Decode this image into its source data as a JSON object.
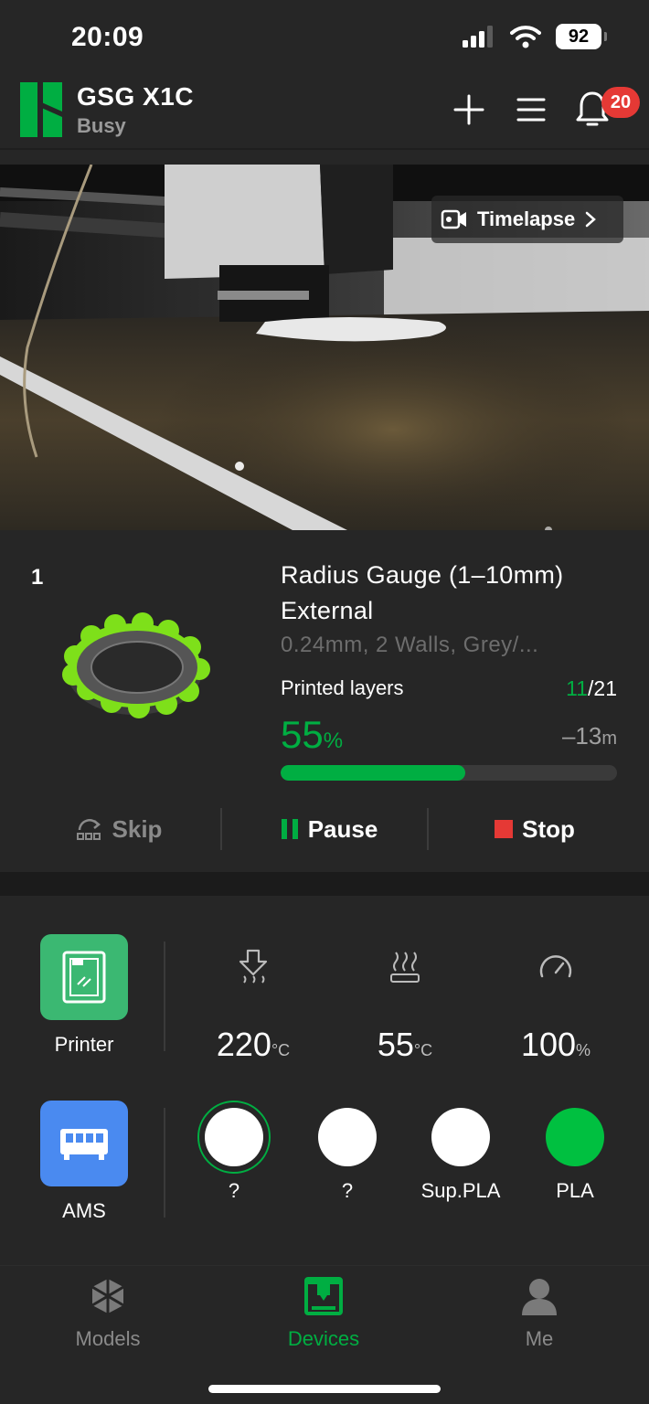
{
  "status_bar": {
    "time": "20:09",
    "battery": "92"
  },
  "header": {
    "printer_name": "GSG X1C",
    "printer_state": "Busy",
    "notification_count": "20"
  },
  "camera": {
    "timelapse_label": "Timelapse"
  },
  "job": {
    "plate_index": "1",
    "title": "Radius Gauge (1–10mm) External",
    "subtitle": "0.24mm, 2 Walls, Grey/...",
    "layers_label": "Printed layers",
    "layers_current": "11",
    "layers_total": "/21",
    "percent_value": "55",
    "percent_unit": "%",
    "progress": 0.55,
    "remaining_value": "–13",
    "remaining_unit": "m",
    "controls": {
      "skip": "Skip",
      "pause": "Pause",
      "stop": "Stop"
    }
  },
  "panel": {
    "printer_tile_label": "Printer",
    "ams_tile_label": "AMS",
    "stats": [
      {
        "icon": "nozzle-temp-icon",
        "value": "220",
        "unit": "°C"
      },
      {
        "icon": "bed-temp-icon",
        "value": "55",
        "unit": "°C"
      },
      {
        "icon": "speed-gauge-icon",
        "value": "100",
        "unit": "%"
      }
    ],
    "ams_slots": [
      {
        "label": "?",
        "color": "#ffffff",
        "selected": true
      },
      {
        "label": "?",
        "color": "#ffffff",
        "selected": false
      },
      {
        "label": "Sup.PLA",
        "color": "#ffffff",
        "selected": false
      },
      {
        "label": "PLA",
        "color": "#00c040",
        "selected": false
      }
    ]
  },
  "bottom_nav": {
    "items": [
      {
        "label": "Models",
        "icon": "models-icon",
        "active": false
      },
      {
        "label": "Devices",
        "icon": "devices-icon",
        "active": true
      },
      {
        "label": "Me",
        "icon": "profile-icon",
        "active": false
      }
    ]
  },
  "colors": {
    "accent": "#00ae42",
    "stop": "#e53935",
    "ams_tile": "#4a8af0",
    "background": "#262626"
  }
}
